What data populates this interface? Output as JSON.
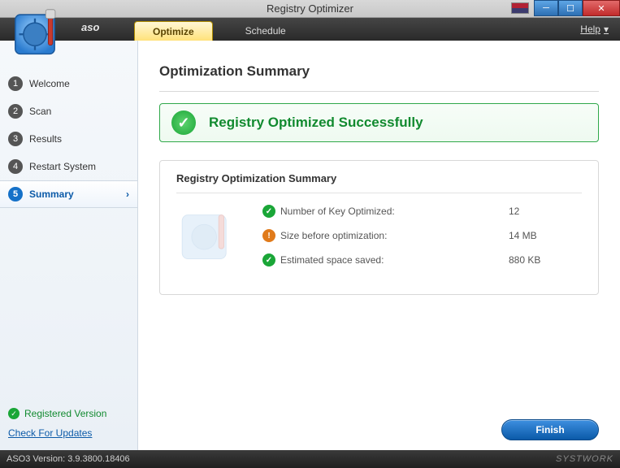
{
  "window": {
    "title": "Registry Optimizer",
    "brand": "aso",
    "help_label": "Help"
  },
  "tabs": {
    "optimize": "Optimize",
    "schedule": "Schedule"
  },
  "sidebar": {
    "steps": [
      {
        "n": "1",
        "label": "Welcome"
      },
      {
        "n": "2",
        "label": "Scan"
      },
      {
        "n": "3",
        "label": "Results"
      },
      {
        "n": "4",
        "label": "Restart System"
      },
      {
        "n": "5",
        "label": "Summary"
      }
    ],
    "registered_label": "Registered Version",
    "updates_label": "Check For Updates"
  },
  "main": {
    "heading": "Optimization Summary",
    "success_message": "Registry Optimized Successfully",
    "panel_title": "Registry Optimization Summary",
    "rows": {
      "keys_label": "Number of Key Optimized:",
      "keys_value": "12",
      "before_label": "Size before optimization:",
      "before_value": "14 MB",
      "saved_label": "Estimated space saved:",
      "saved_value": "880 KB"
    },
    "finish_label": "Finish"
  },
  "status": {
    "version_label": "ASO3 Version: 3.9.3800.18406",
    "vendor": "SYSTWORK"
  }
}
